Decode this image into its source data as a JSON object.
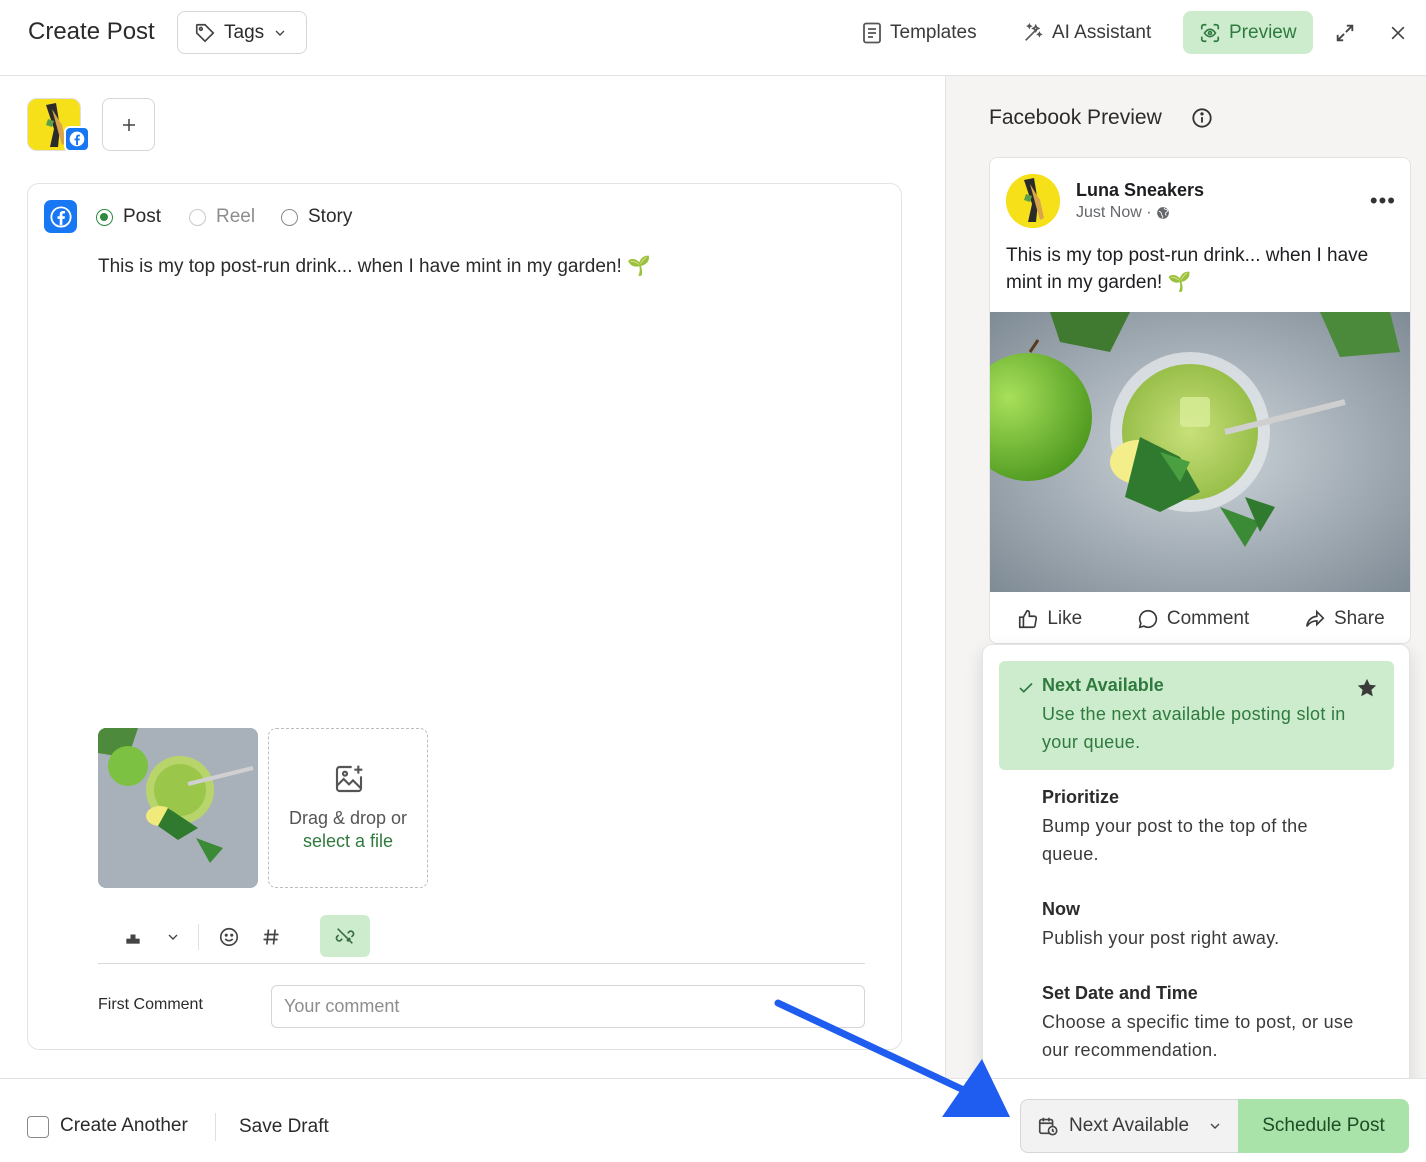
{
  "header": {
    "title": "Create Post",
    "tags_label": "Tags",
    "templates_label": "Templates",
    "ai_label": "AI Assistant",
    "preview_label": "Preview"
  },
  "composer": {
    "post_types": [
      "Post",
      "Reel",
      "Story"
    ],
    "selected_post_type": "Post",
    "text": "This is my top post-run drink... when I have mint in my garden! 🌱",
    "dropzone_line1": "Drag & drop or",
    "dropzone_link": "select a file",
    "first_comment_label": "First Comment",
    "first_comment_placeholder": "Your comment"
  },
  "preview": {
    "title": "Facebook Preview",
    "account_name": "Luna Sneakers",
    "meta": "Just Now ·",
    "text": "This is my top post-run drink... when I have mint in my garden! 🌱",
    "actions": [
      "Like",
      "Comment",
      "Share"
    ]
  },
  "schedule_menu": {
    "items": [
      {
        "title": "Next Available",
        "desc": "Use the next available posting slot in your queue."
      },
      {
        "title": "Prioritize",
        "desc": "Bump your post to the top of the queue."
      },
      {
        "title": "Now",
        "desc": "Publish your post right away."
      },
      {
        "title": "Set Date and Time",
        "desc": "Choose a specific time to post, or use our recommendation."
      }
    ],
    "selected": "Next Available"
  },
  "footer": {
    "create_another_label": "Create Another",
    "save_draft_label": "Save Draft",
    "schedule_mode_label": "Next Available",
    "schedule_button_label": "Schedule Post"
  },
  "colors": {
    "accent_green": "#cdeccd",
    "accent_green_text": "#2f7a3e",
    "facebook_blue": "#1877f2",
    "annotation_arrow": "#1f5cf0"
  }
}
